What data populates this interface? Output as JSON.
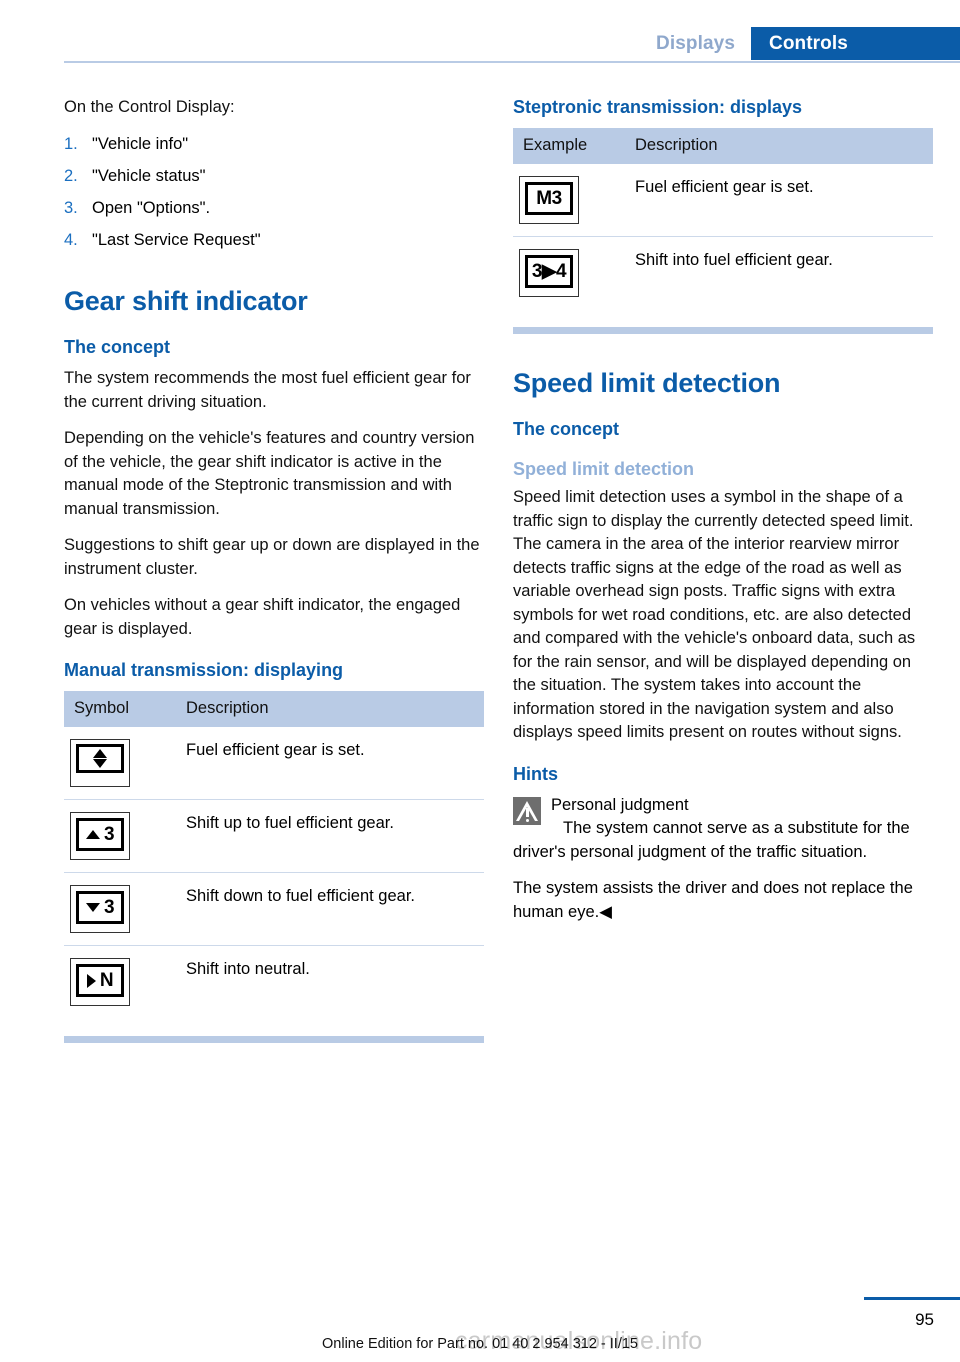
{
  "header": {
    "tab_inactive": "Displays",
    "tab_active": "Controls",
    "accent_blue": "#0b5ca8",
    "light_blue": "#b9cbe5"
  },
  "left_column": {
    "intro": "On the Control Display:",
    "steps": [
      {
        "num": "1.",
        "text": "\"Vehicle info\""
      },
      {
        "num": "2.",
        "text": "\"Vehicle status\""
      },
      {
        "num": "3.",
        "text": "Open \"Options\"."
      },
      {
        "num": "4.",
        "text": "\"Last Service Request\""
      }
    ],
    "chapter_title": "Gear shift indicator",
    "concept_heading": "The concept",
    "concept_paragraphs": [
      "The system recommends the most fuel efficient gear for the current driving situation.",
      "Depending on the vehicle's features and country version of the vehicle, the gear shift indicator is active in the manual mode of the Steptronic transmission and with manual transmission.",
      "Suggestions to shift gear up or down are displayed in the instrument cluster.",
      "On vehicles without a gear shift indicator, the engaged gear is displayed."
    ],
    "manual_heading": "Manual transmission: displaying",
    "manual_table": {
      "columns": [
        "Symbol",
        "Description"
      ],
      "rows": [
        {
          "symbol": "up-down-arrows",
          "symbol_text": "",
          "description": "Fuel efficient gear is set."
        },
        {
          "symbol": "arrow-up-3",
          "symbol_text": "3",
          "description": "Shift up to fuel efficient gear."
        },
        {
          "symbol": "arrow-down-3",
          "symbol_text": "3",
          "description": "Shift down to fuel efficient gear."
        },
        {
          "symbol": "arrow-right-n",
          "symbol_text": "N",
          "description": "Shift into neutral."
        }
      ]
    }
  },
  "right_column": {
    "steptronic_heading": "Steptronic transmission: displays",
    "steptronic_table": {
      "columns": [
        "Example",
        "Description"
      ],
      "rows": [
        {
          "symbol": "gear-m3",
          "symbol_text": "M3",
          "description": "Fuel efficient gear is set."
        },
        {
          "symbol": "gear-3-to-4",
          "symbol_text": "3▶4",
          "description": "Shift into fuel efficient gear."
        }
      ]
    },
    "chapter_title": "Speed limit detection",
    "concept_heading": "The concept",
    "subsection_heading": "Speed limit detection",
    "concept_paragraph": "Speed limit detection uses a symbol in the shape of a traffic sign to display the currently detected speed limit. The camera in the area of the interior rearview mirror detects traffic signs at the edge of the road as well as variable overhead sign posts. Traffic signs with extra symbols for wet road conditions, etc. are also detected and compared with the vehicle's onboard data, such as for the rain sensor, and will be displayed depending on the situation. The system takes into account the information stored in the navigation system and also displays speed limits present on routes without signs.",
    "hints_heading": "Hints",
    "hint_title": "Personal judgment",
    "hint_paragraphs": [
      "The system cannot serve as a substitute for the driver's personal judgment of the traffic situation.",
      "The system assists the driver and does not replace the human eye.◀"
    ]
  },
  "footer": {
    "edition_note": "Online Edition for Part no. 01 40 2 954 312 - II/15",
    "watermark": "carmanualsonline.info",
    "page_number": "95"
  }
}
